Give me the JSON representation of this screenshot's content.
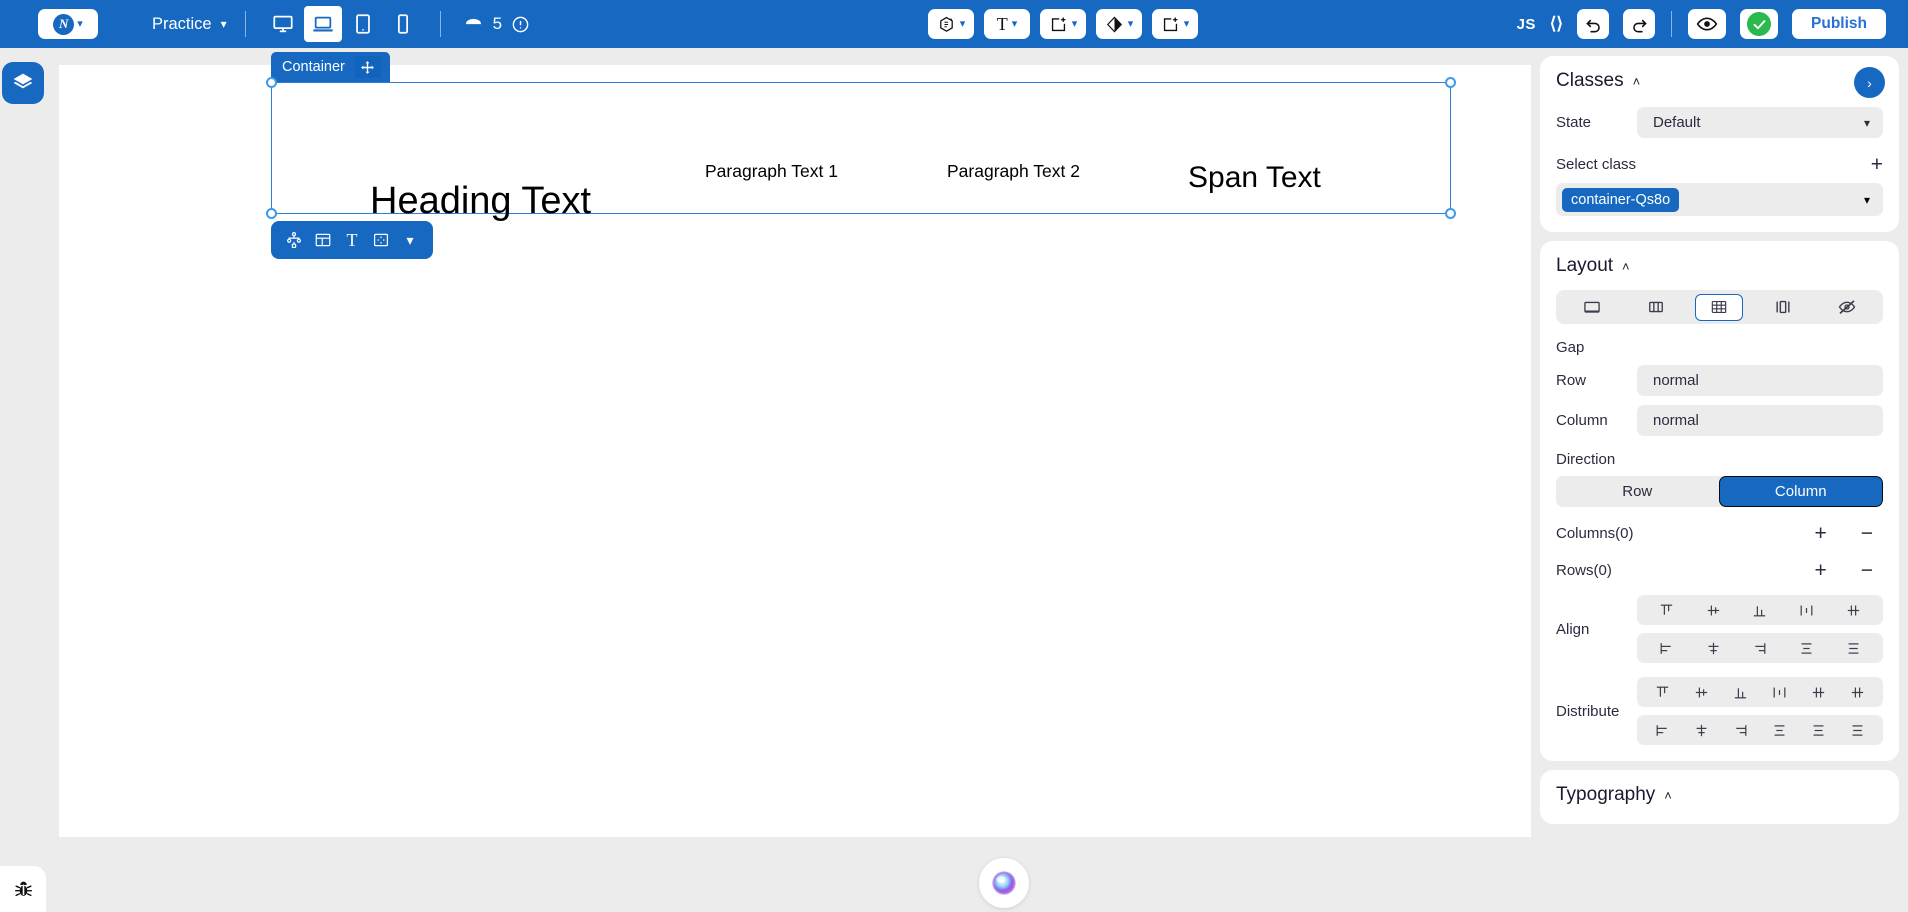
{
  "topbar": {
    "logo_letter": "N",
    "logo_caret": "⌄",
    "project_name": "Practice",
    "project_caret": "⌄",
    "breakpoints": [
      {
        "name": "desktop-breakpoint",
        "icon": "monitor-icon",
        "active": false
      },
      {
        "name": "laptop-breakpoint",
        "icon": "laptop-icon",
        "active": true
      },
      {
        "name": "tablet-breakpoint",
        "icon": "tablet-icon",
        "active": false
      },
      {
        "name": "mobile-breakpoint",
        "icon": "mobile-icon",
        "active": false
      }
    ],
    "pages_count": "5",
    "insert_buttons": [
      {
        "name": "component-insert",
        "icon": "cube-icon"
      },
      {
        "name": "text-insert",
        "icon": "text-T-icon"
      },
      {
        "name": "container-insert",
        "icon": "add-box-icon"
      },
      {
        "name": "media-insert",
        "icon": "diamond-icon"
      },
      {
        "name": "element-insert",
        "icon": "add-box-icon"
      }
    ],
    "js_label": "JS",
    "code_label": "‹›",
    "undo_label": "undo",
    "redo_label": "redo",
    "preview_label": "preview",
    "publish_label": "Publish"
  },
  "canvas": {
    "selection_tag": "Container",
    "elements": {
      "heading": "Heading Text",
      "paragraph1": "Paragraph Text 1",
      "paragraph2": "Paragraph Text 2",
      "span": "Span Text"
    },
    "element_toolbar": [
      {
        "name": "element-tree-button",
        "icon": "sitemap-icon"
      },
      {
        "name": "layout-button",
        "icon": "layout-grid-icon"
      },
      {
        "name": "text-button",
        "icon": "text-T-icon"
      },
      {
        "name": "spacing-button",
        "icon": "spacing-box-icon"
      },
      {
        "name": "more-button",
        "icon": "chevron-down-icon"
      }
    ],
    "ai_assistant": "ai-orb"
  },
  "left_rail": {
    "layers_button": "layers-icon",
    "bug_button": "bug-icon"
  },
  "classes_panel": {
    "title": "Classes",
    "collapse_caret": "˄",
    "next_arrow": "›",
    "state_label": "State",
    "state_value": "Default",
    "state_caret": "⌄",
    "select_class_label": "Select class",
    "add_class": "+",
    "class_chip": "container-Qs8o",
    "class_caret": "⌄"
  },
  "layout_panel": {
    "title": "Layout",
    "collapse_caret": "˄",
    "display_modes": [
      {
        "name": "display-block",
        "icon": "block-icon",
        "active": false
      },
      {
        "name": "display-flex",
        "icon": "flex-icon",
        "active": false
      },
      {
        "name": "display-grid",
        "icon": "grid-icon",
        "active": true
      },
      {
        "name": "display-inline-block",
        "icon": "inline-block-icon",
        "active": false
      },
      {
        "name": "display-none",
        "icon": "eye-off-icon",
        "active": false
      }
    ],
    "gap_label": "Gap",
    "row_label": "Row",
    "row_value": "normal",
    "column_label": "Column",
    "column_value": "normal",
    "direction_label": "Direction",
    "direction_row": "Row",
    "direction_column": "Column",
    "direction_active": "Column",
    "columns_label": "Columns(0)",
    "rows_label": "Rows(0)",
    "plus": "+",
    "minus": "−",
    "align_label": "Align",
    "distribute_label": "Distribute",
    "align_row1": [
      "align-start-vertical-icon",
      "align-center-vertical-icon",
      "align-end-vertical-icon",
      "align-stretch-vertical-icon",
      "align-baseline-vertical-icon"
    ],
    "align_row2": [
      "align-start-horizontal-icon",
      "align-center-horizontal-icon",
      "align-end-horizontal-icon",
      "align-stretch-horizontal-icon",
      "align-baseline-horizontal-icon"
    ],
    "distribute_row1": [
      "distribute-start-v-icon",
      "distribute-center-v-icon",
      "distribute-end-v-icon",
      "distribute-stretch-v-icon",
      "distribute-between-v-icon",
      "distribute-around-v-icon"
    ],
    "distribute_row2": [
      "distribute-start-h-icon",
      "distribute-center-h-icon",
      "distribute-end-h-icon",
      "distribute-stretch-h-icon",
      "distribute-between-h-icon",
      "distribute-around-h-icon"
    ]
  },
  "typography_panel": {
    "title": "Typography",
    "collapse_caret": "˄"
  },
  "colors": {
    "brand_blue": "#1668c1",
    "panel_bg": "#ececec",
    "card_bg": "#ffffff",
    "green": "#2bb84c",
    "selection_blue": "#2f7fd8",
    "publish_text": "#2a6fd4"
  }
}
